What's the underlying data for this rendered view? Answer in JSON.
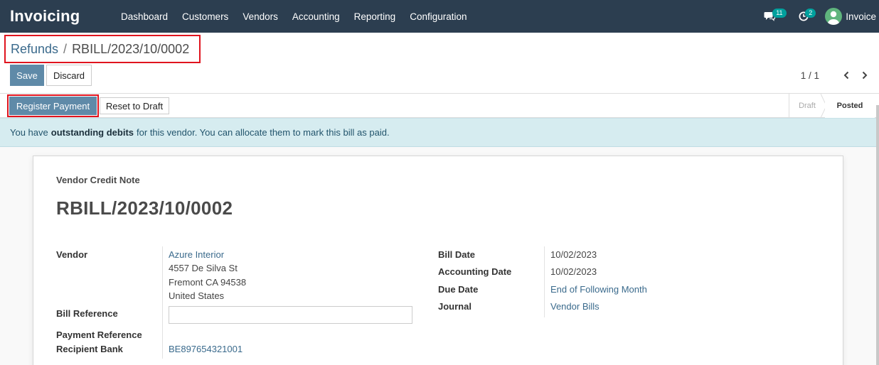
{
  "navbar": {
    "app_name": "Invoicing",
    "menu": [
      "Dashboard",
      "Customers",
      "Vendors",
      "Accounting",
      "Reporting",
      "Configuration"
    ],
    "messages_count": "11",
    "activities_count": "2",
    "user_name": "Invoice"
  },
  "breadcrumb": {
    "parent": "Refunds",
    "separator": "/",
    "current": "RBILL/2023/10/0002"
  },
  "buttons": {
    "save": "Save",
    "discard": "Discard",
    "register_payment": "Register Payment",
    "reset_to_draft": "Reset to Draft"
  },
  "pager": {
    "value": "1 / 1"
  },
  "statusbar": {
    "stages": [
      "Draft",
      "Posted"
    ],
    "active_stage": "Posted"
  },
  "alert": {
    "prefix": "You have",
    "bold": "outstanding debits",
    "suffix": "for this vendor. You can allocate them to mark this bill as paid."
  },
  "form": {
    "doc_type": "Vendor Credit Note",
    "doc_number": "RBILL/2023/10/0002",
    "vendor_label": "Vendor",
    "vendor_name": "Azure Interior",
    "vendor_address": [
      "4557 De Silva St",
      "Fremont CA 94538",
      "United States"
    ],
    "bill_reference_label": "Bill Reference",
    "bill_reference_value": "",
    "payment_reference_label": "Payment Reference",
    "recipient_bank_label": "Recipient Bank",
    "recipient_bank_value": "BE897654321001",
    "bill_date_label": "Bill Date",
    "bill_date_value": "10/02/2023",
    "accounting_date_label": "Accounting Date",
    "accounting_date_value": "10/02/2023",
    "due_date_label": "Due Date",
    "due_date_value": "End of Following Month",
    "journal_label": "Journal",
    "journal_value": "Vendor Bills"
  },
  "colors": {
    "navbar_bg": "#2c3e50",
    "primary_button": "#5f8aa8",
    "link": "#3a6a8c",
    "alert_bg": "#d6ecf0",
    "highlight_outline": "#e0141e",
    "badge": "#00a09d"
  }
}
